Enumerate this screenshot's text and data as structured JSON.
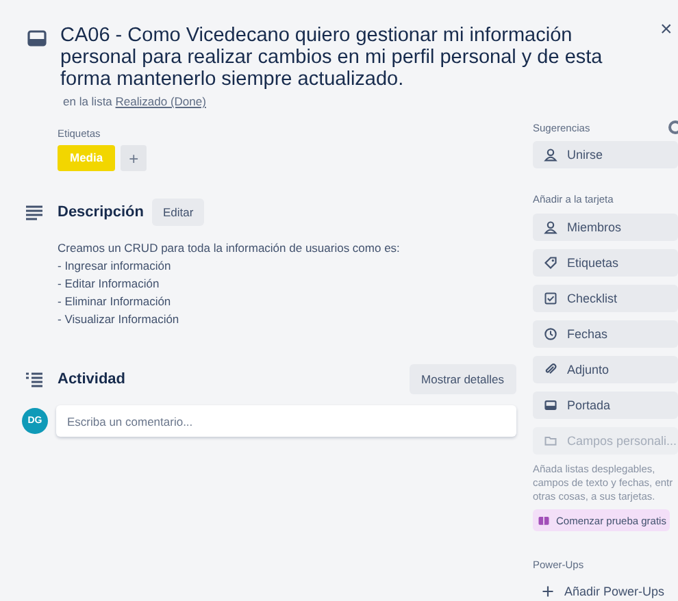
{
  "card": {
    "title": "CA06 - Como Vicedecano quiero gestionar mi información personal para realizar cambios en mi perfil personal y de esta forma mantenerlo siempre actualizado.",
    "list_prefix": "en la lista",
    "list_name": "Realizado (Done)",
    "close": "×"
  },
  "labels": {
    "heading": "Etiquetas",
    "items": [
      {
        "text": "Media",
        "color": "#f2d600"
      }
    ],
    "add": "+"
  },
  "description": {
    "heading": "Descripción",
    "edit": "Editar",
    "lines": [
      "Creamos un CRUD para toda la información de usuarios como es:",
      "- Ingresar información",
      "- Editar Información",
      "- Eliminar Información",
      "- Visualizar Información"
    ]
  },
  "activity": {
    "heading": "Actividad",
    "details_button": "Mostrar detalles",
    "avatar": "DG",
    "comment": {
      "placeholder": "Escriba un comentario..."
    }
  },
  "sidebar": {
    "suggestions": {
      "heading": "Sugerencias",
      "items": [
        {
          "kind": "person",
          "label": "Unirse",
          "disabled": false
        }
      ]
    },
    "add_to_card": {
      "heading": "Añadir a la tarjeta",
      "items": [
        {
          "kind": "person",
          "label": "Miembros",
          "disabled": false
        },
        {
          "kind": "tag",
          "label": "Etiquetas",
          "disabled": false
        },
        {
          "kind": "checkbox",
          "label": "Checklist",
          "disabled": false
        },
        {
          "kind": "clock",
          "label": "Fechas",
          "disabled": false
        },
        {
          "kind": "clip",
          "label": "Adjunto",
          "disabled": false
        },
        {
          "kind": "cover",
          "label": "Portada",
          "disabled": false
        },
        {
          "kind": "fields",
          "label": "Campos personali...",
          "disabled": true
        }
      ]
    },
    "upsell": {
      "text": "Añada listas desplegables, campos de texto y fechas, entr otras cosas, a sus tarjetas.",
      "button": "Comenzar prueba gratis"
    },
    "power_ups": {
      "heading": "Power-Ups",
      "add": "Añadir Power-Ups"
    }
  }
}
